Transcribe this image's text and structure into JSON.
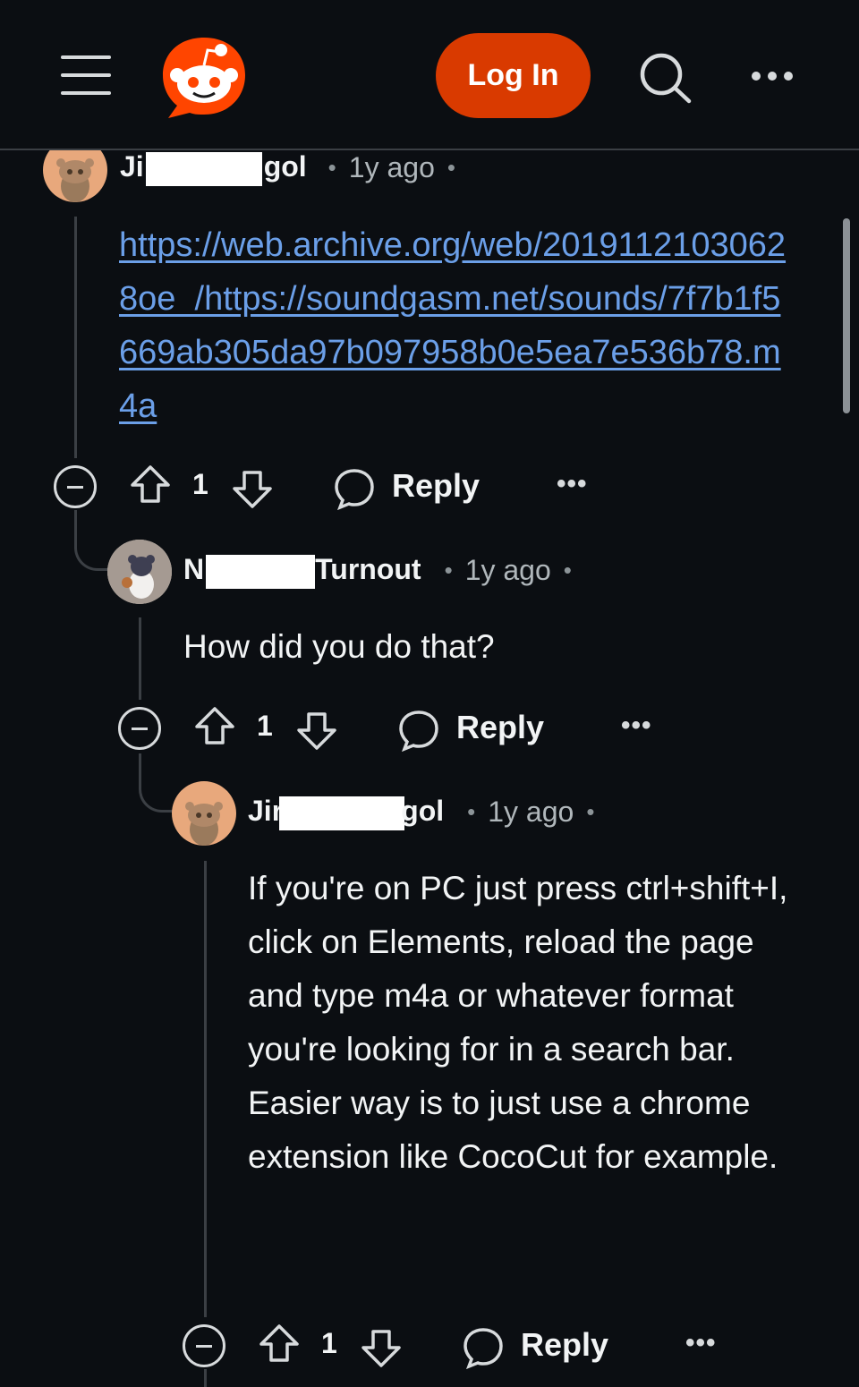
{
  "header": {
    "login_label": "Log In",
    "brand_color": "#d93a00",
    "icons": [
      "menu-icon",
      "reddit-logo",
      "search-icon",
      "more-icon"
    ]
  },
  "comments": [
    {
      "author_prefix": "Ji",
      "author_suffix": "gol",
      "time": "1y ago",
      "link_text": "https://web.archive.org/web/20191121030628oe_/https://soundgasm.net/sounds/7f7b1f5669ab305da97b097958b0e5ea7e536b78.m4a",
      "votes": "1",
      "reply_label": "Reply",
      "more_label": "•••"
    },
    {
      "author_prefix": "N",
      "author_suffix": "Turnout",
      "time": "1y ago",
      "body": "How did you do that?",
      "votes": "1",
      "reply_label": "Reply",
      "more_label": "•••"
    },
    {
      "author_prefix": "Jir",
      "author_suffix": "gol",
      "time": "1y ago",
      "body": "If you're on PC just press ctrl+shift+I, click on Elements, reload the page and type m4a or whatever format you're looking for in a search bar. Easier way is to just use a chrome extension like CocoCut for example.",
      "votes": "1",
      "reply_label": "Reply",
      "more_label": "•••"
    }
  ],
  "separator": "•"
}
